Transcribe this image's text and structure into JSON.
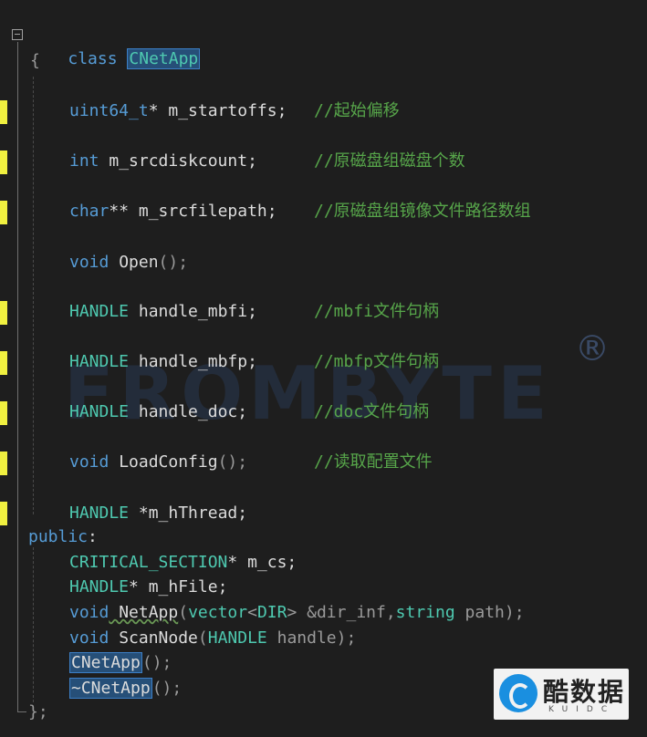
{
  "editor": {
    "theme_bg": "#1e1e1e",
    "lines": {
      "class_kw": "class",
      "class_name": "CNetApp",
      "open_brace": "{",
      "l1_type": "uint64_t",
      "l1_rest": "* m_startoffs;",
      "l1_comment": "//起始偏移",
      "l2_type": "int",
      "l2_rest": " m_srcdiskcount;",
      "l2_comment": "//原磁盘组磁盘个数",
      "l3_type": "char",
      "l3_rest": "** m_srcfilepath;",
      "l3_comment": "//原磁盘组镜像文件路径数组",
      "l4_type": "void",
      "l4_name": " Open",
      "l4_paren": "();",
      "l5_type": "HANDLE",
      "l5_rest": " handle_mbfi;",
      "l5_comment": "//mbfi文件句柄",
      "l6_type": "HANDLE",
      "l6_rest": " handle_mbfp;",
      "l6_comment": "//mbfp文件句柄",
      "l7_type": "HANDLE",
      "l7_rest": " handle_doc;",
      "l7_comment": "//doc文件句柄",
      "l8_type": "void",
      "l8_name": " LoadConfig",
      "l8_paren": "();",
      "l8_comment": "//读取配置文件",
      "l9_type": "HANDLE",
      "l9_rest": " *m_hThread;",
      "public_kw": "public",
      "public_colon": ":",
      "p1_type": "CRITICAL_SECTION",
      "p1_rest": "* m_cs;",
      "p2_type": "HANDLE",
      "p2_rest": "* m_hFile;",
      "p3_type": "void",
      "p3_name": " NetApp",
      "p3_paren_open": "(",
      "p3_vec": "vector",
      "p3_lt": "<",
      "p3_dir": "DIR",
      "p3_gt": ">",
      "p3_arg1": " &dir_inf,",
      "p3_str": "string",
      "p3_arg2": " path",
      "p3_close": ");",
      "p4_type": "void",
      "p4_name": " ScanNode",
      "p4_paren_open": "(",
      "p4_handle": "HANDLE",
      "p4_arg": " handle",
      "p4_close": ");",
      "p5_name": "CNetApp",
      "p5_paren": "();",
      "p6_name": "~CNetApp",
      "p6_paren": "();",
      "close_brace": "};"
    }
  },
  "watermark": {
    "text": "FROMBYTE",
    "reg": "®"
  },
  "logo": {
    "text": "酷数据",
    "sub": "KUIDC"
  }
}
